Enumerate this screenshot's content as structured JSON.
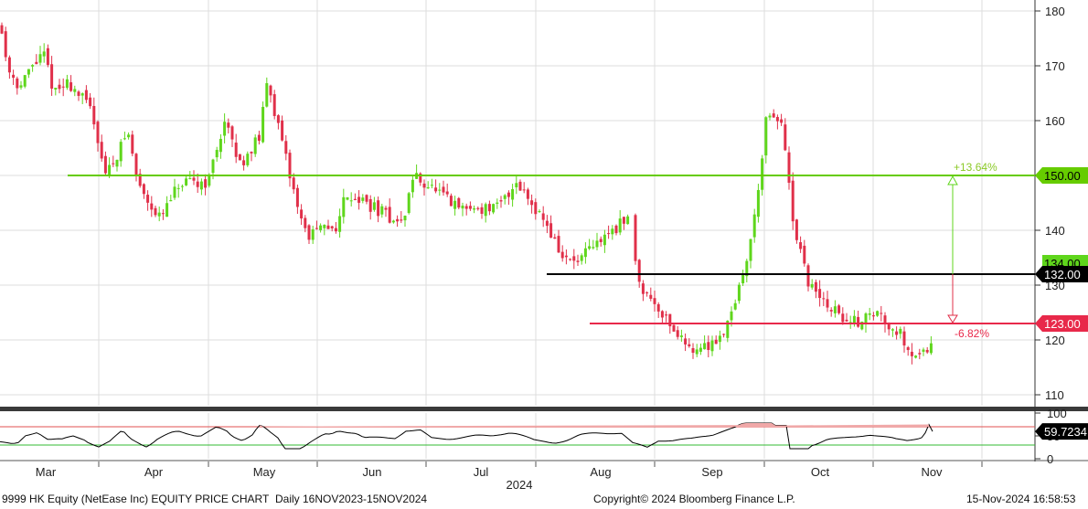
{
  "chart_data": {
    "type": "candlestick",
    "ticker": "9999 HK Equity (NetEase Inc) EQUITY PRICE CHART",
    "frequency": "Daily 16NOV2023-15NOV2024",
    "copyright": "Copyright© 2024 Bloomberg Finance L.P.",
    "timestamp": "15-Nov-2024 16:58:53",
    "year_label": "2024",
    "months": [
      "Mar",
      "Apr",
      "May",
      "Jun",
      "Jul",
      "Aug",
      "Sep",
      "Oct",
      "Nov"
    ],
    "price_axis": {
      "ticks": [
        110,
        120,
        130,
        140,
        150,
        160,
        170,
        180
      ],
      "range": [
        108,
        182
      ]
    },
    "rsi_axis": {
      "ticks": [
        0,
        50,
        100
      ],
      "range": [
        0,
        100
      ]
    },
    "grid": true,
    "up_color": "#5fd61c",
    "down_color": "#e0304a",
    "levels": [
      {
        "value": 150.0,
        "label": "150.00",
        "color": "#66cc00",
        "tag_text_color": "#000000"
      },
      {
        "value": 132.0,
        "label": "132.00",
        "color": "#000000",
        "tag_text_color": "#ffffff"
      },
      {
        "value": 123.0,
        "label": "123.00",
        "color": "#e8294a",
        "tag_text_color": "#ffffff"
      }
    ],
    "last_price_label": "134.00",
    "annotations": [
      {
        "text": "+13.64%",
        "color": "#8ac926"
      },
      {
        "text": "-6.82%",
        "color": "#e8294a"
      }
    ],
    "rsi": {
      "value_label": "59.7234",
      "upper_band": 70,
      "lower_band": 30,
      "upper_color": "#e05050",
      "lower_color": "#33bb33"
    }
  }
}
